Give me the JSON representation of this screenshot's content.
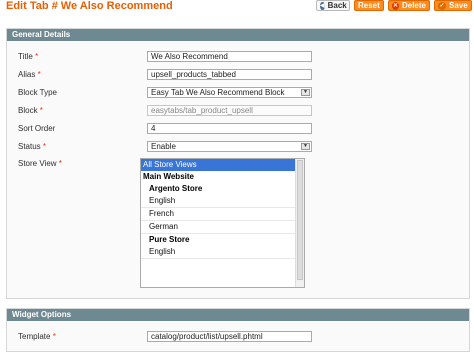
{
  "header": {
    "title": "Edit Tab # We Also Recommend",
    "buttons": {
      "back": "Back",
      "reset": "Reset",
      "delete": "Delete",
      "save": "Save"
    }
  },
  "general": {
    "heading": "General Details",
    "title_label": "Title",
    "title_value": "We Also Recommend",
    "alias_label": "Alias",
    "alias_value": "upsell_products_tabbed",
    "block_type_label": "Block Type",
    "block_type_value": "Easy Tab We Also Recommend Block",
    "block_label": "Block",
    "block_value": "easytabs/tab_product_upsell",
    "sort_order_label": "Sort Order",
    "sort_order_value": "4",
    "status_label": "Status",
    "status_value": "Enable",
    "store_view_label": "Store View",
    "store_views": [
      "All Store Views",
      "Main Website",
      "Argento Store",
      "English",
      "French",
      "German",
      "Pure Store",
      "English"
    ]
  },
  "widget": {
    "heading": "Widget Options",
    "template_label": "Template",
    "template_value": "catalog/product/list/upsell.phtml"
  },
  "required_mark": "*",
  "colors": {
    "title_orange": "#eb5e00",
    "button_orange": "#ff8a1e",
    "section_head": "#6f8992",
    "selection_blue": "#3875d7"
  }
}
